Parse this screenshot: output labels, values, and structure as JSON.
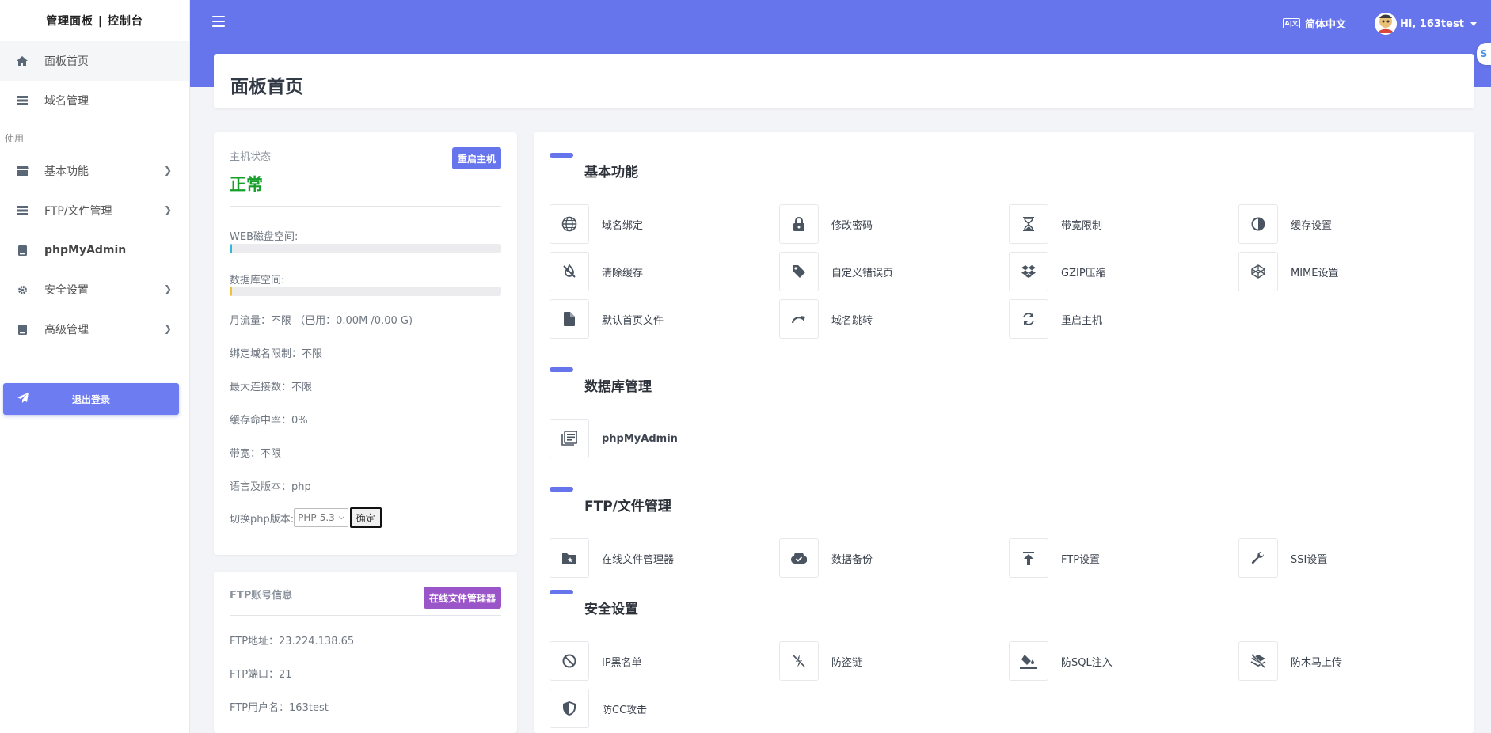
{
  "sidebar": {
    "brand": "管理面板 | 控制台",
    "items_top": [
      {
        "label": "面板首页"
      },
      {
        "label": "域名管理"
      }
    ],
    "section_label": "使用",
    "items": [
      {
        "label": "基本功能"
      },
      {
        "label": "FTP/文件管理"
      },
      {
        "label": "phpMyAdmin"
      },
      {
        "label": "安全设置"
      },
      {
        "label": "高级管理"
      }
    ],
    "logout": "退出登录"
  },
  "topbar": {
    "language": "简体中文",
    "user": "Hi, 163test",
    "side_tab": "S"
  },
  "page_title": "面板首页",
  "host": {
    "caption": "主机状态",
    "restart_btn": "重启主机",
    "status": "正常",
    "web_disk_label": "WEB磁盘空间:",
    "web_disk_fill": 0.01,
    "db_space_label": "数据库空间:",
    "db_space_fill": 0.01,
    "monthly_traffic": "月流量：不限 （已用：0.00M /0.00 G)",
    "domain_limit": "绑定域名限制：不限",
    "max_conn": "最大连接数：不限",
    "cache_hit": "缓存命中率：0%",
    "bandwidth": "带宽：不限",
    "lang_version": "语言及版本：php",
    "php_switch_label": "切换php版本:",
    "php_selected": "PHP-5.3",
    "confirm_btn": "确定"
  },
  "ftp": {
    "caption": "FTP账号信息",
    "file_mgr_btn": "在线文件管理器",
    "address": "FTP地址：23.224.138.65",
    "port": "FTP端口：21",
    "username": "FTP用户名：163test"
  },
  "functions": {
    "basic_title": "基本功能",
    "basic": [
      {
        "label": "域名绑定",
        "icon": "globe-icon"
      },
      {
        "label": "修改密码",
        "icon": "lock-icon"
      },
      {
        "label": "带宽限制",
        "icon": "hourglass-icon"
      },
      {
        "label": "缓存设置",
        "icon": "contrast-icon"
      },
      {
        "label": "清除缓存",
        "icon": "no-fire-icon"
      },
      {
        "label": "自定义错误页",
        "icon": "tag-icon"
      },
      {
        "label": "GZIP压缩",
        "icon": "dropbox-icon"
      },
      {
        "label": "MIME设置",
        "icon": "codepen-icon"
      },
      {
        "label": "默认首页文件",
        "icon": "file-icon"
      },
      {
        "label": "域名跳转",
        "icon": "redo-icon"
      },
      {
        "label": "重启主机",
        "icon": "sync-icon"
      }
    ],
    "db_title": "数据库管理",
    "db": [
      {
        "label": "phpMyAdmin",
        "icon": "book-icon"
      }
    ],
    "ftp_title": "FTP/文件管理",
    "ftp": [
      {
        "label": "在线文件管理器",
        "icon": "folder-star-icon"
      },
      {
        "label": "数据备份",
        "icon": "cloud-check-icon"
      },
      {
        "label": "FTP设置",
        "icon": "upload-icon"
      },
      {
        "label": "SSI设置",
        "icon": "wrench-icon"
      }
    ],
    "sec_title": "安全设置",
    "sec": [
      {
        "label": "IP黑名单",
        "icon": "ban-icon"
      },
      {
        "label": "防盗链",
        "icon": "unlink-icon"
      },
      {
        "label": "防SQL注入",
        "icon": "fill-drip-icon"
      },
      {
        "label": "防木马上传",
        "icon": "layer-off-icon"
      },
      {
        "label": "防CC攻击",
        "icon": "shield-icon"
      }
    ]
  },
  "colors": {
    "accent": "#6675ec",
    "status_ok": "#16a02a",
    "pill_ftp": "#9a55c8",
    "bar_web": "#35b7d8",
    "bar_db": "#f0c232"
  }
}
